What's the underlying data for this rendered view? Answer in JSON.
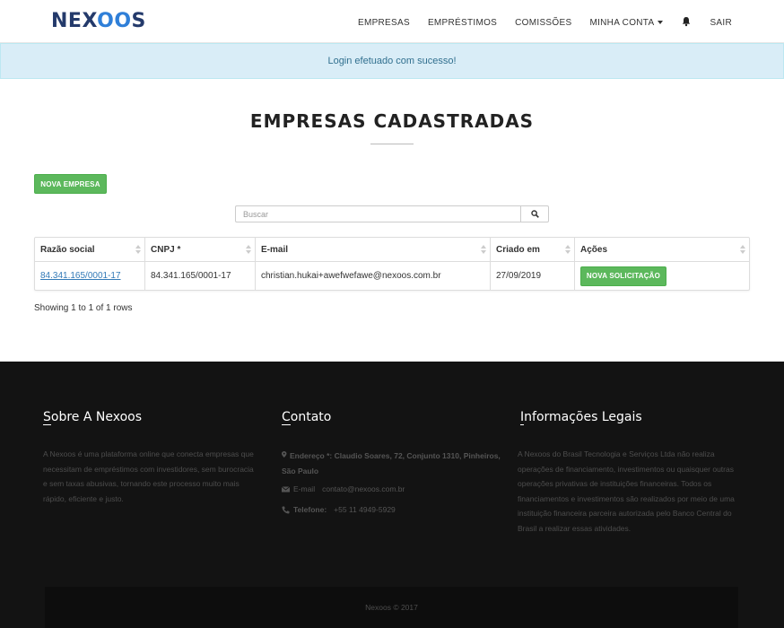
{
  "brand": {
    "logo_left": "NEX",
    "logo_oo": "OO",
    "logo_right": "S"
  },
  "nav": {
    "items": [
      "EMPRESAS",
      "EMPRÉSTIMOS",
      "COMISSÕES"
    ],
    "account": "MINHA CONTA",
    "logout": "SAIR"
  },
  "alert": {
    "message": "Login efetuado com sucesso!"
  },
  "page": {
    "title": "EMPRESAS CADASTRADAS",
    "new_company_button": "NOVA EMPRESA",
    "search_placeholder": "Buscar"
  },
  "table": {
    "headers": [
      "Razão social",
      "CNPJ *",
      "E-mail",
      "Criado em",
      "Ações"
    ],
    "rows": [
      {
        "razao_social": "84.341.165/0001-17",
        "cnpj": "84.341.165/0001-17",
        "email": "christian.hukai+awefwefawe@nexoos.com.br",
        "criado_em": "27/09/2019",
        "acao": "NOVA SOLICITAÇÃO"
      }
    ],
    "showing": "Showing 1 to 1 of 1 rows"
  },
  "footer": {
    "about": {
      "title_first": "S",
      "title_rest": "obre A Nexoos",
      "text": "A Nexoos é uma plataforma online que conecta empresas que necessitam de empréstimos com investidores, sem burocracia e sem taxas abusivas, tornando este processo muito mais rápido, eficiente e justo."
    },
    "contact": {
      "title_first": "C",
      "title_rest": "ontato",
      "address_label": "Endereço *:",
      "address": "Claudio Soares, 72, Conjunto 1310, Pinheiros, São Paulo",
      "email_label": "E-mail",
      "email": "contato@nexoos.com.br",
      "phone_label": "Telefone:",
      "phone": "+55 11 4949-5929"
    },
    "legal": {
      "title_first": "I",
      "title_rest": "nformações Legais",
      "text": "A Nexoos do Brasil Tecnologia e Serviços Ltda não realiza operações de financiamento, investimentos ou quaisquer outras operações privativas de instituições financeiras. Todos os financiamentos e investimentos são realizados por meio de uma instituição financeira parceira autorizada pelo Banco Central do Brasil a realizar essas atividades."
    },
    "copyright": "Nexoos © 2017"
  },
  "colors": {
    "brand_dark": "#243a6b",
    "brand_light": "#2f7fd8",
    "success": "#5cb85c",
    "alert_bg": "#d9edf7",
    "footer_bg": "#131313"
  }
}
